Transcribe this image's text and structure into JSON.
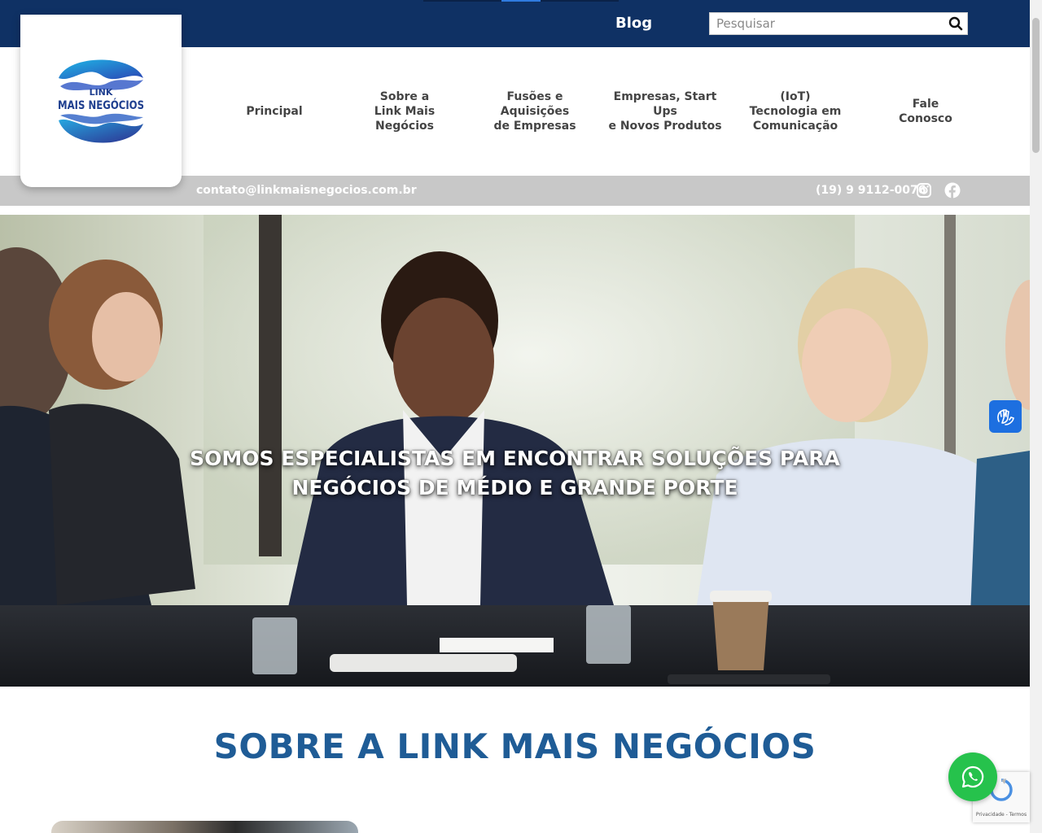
{
  "header": {
    "blog_label": "Blog",
    "search_placeholder": "Pesquisar"
  },
  "logo": {
    "line1": "LINK",
    "line2": "MAIS NEGÓCIOS",
    "brand_color": "#1f3f8f"
  },
  "nav": {
    "items": [
      {
        "label": "Principal"
      },
      {
        "label": "Sobre a\nLink Mais\nNegócios"
      },
      {
        "label": "Fusões e\nAquisições\nde Empresas"
      },
      {
        "label": "Empresas, Start\nUps\ne Novos Produtos"
      },
      {
        "label": "(IoT)\nTecnologia em\nComunicação"
      },
      {
        "label": "Fale\nConosco"
      }
    ]
  },
  "contact": {
    "email": "contato@linkmaisnegocios.com.br",
    "phone": "(19) 9 9112-0076",
    "social": [
      "instagram-icon",
      "facebook-icon"
    ]
  },
  "hero": {
    "line1": "SOMOS ESPECIALISTAS EM ENCONTRAR SOLUÇÕES PARA",
    "line2": "NEGÓCIOS DE MÉDIO E GRANDE PORTE"
  },
  "about": {
    "title": "SOBRE A LINK MAIS NEGÓCIOS"
  },
  "recaptcha": {
    "text": "Privacidade - Termos"
  },
  "colors": {
    "topbar": "#0f3164",
    "contactbar": "#c8c8c8",
    "title": "#1f5c96",
    "whatsapp": "#26c24c",
    "libras": "#1d6fe0"
  }
}
